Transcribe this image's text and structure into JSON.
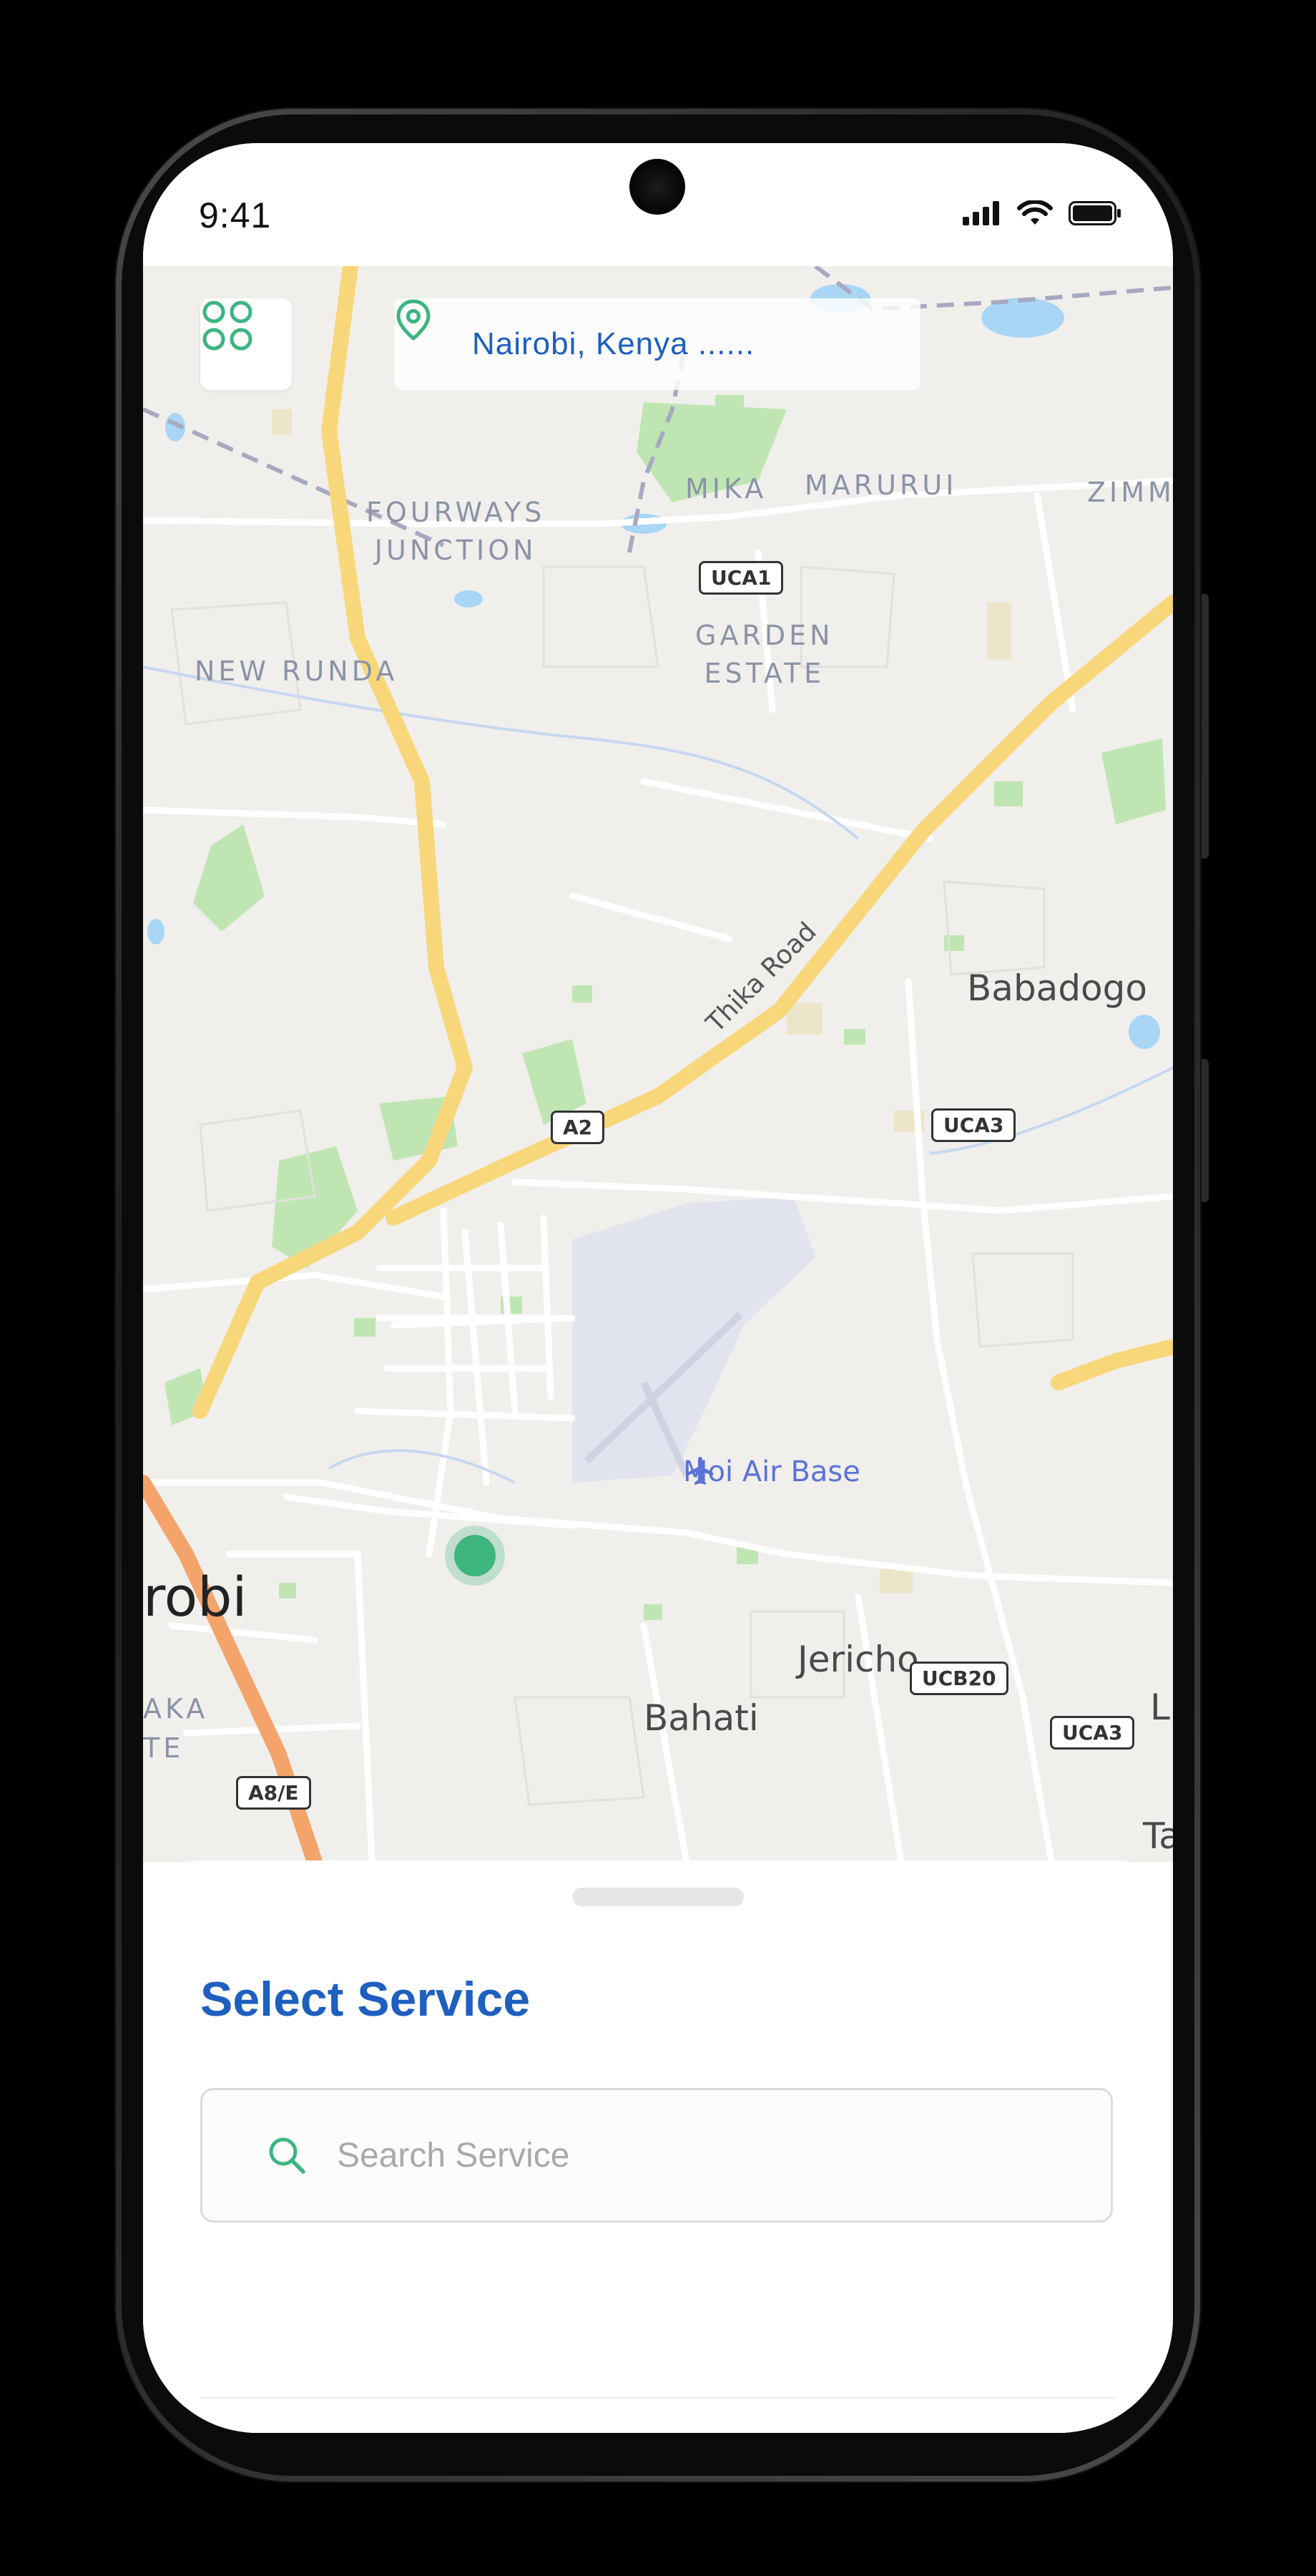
{
  "status_bar": {
    "time": "9:41"
  },
  "map": {
    "location_text": "Nairobi, Kenya ......",
    "area_labels": {
      "fourways_1": "FOURWAYS",
      "fourways_2": "JUNCTION",
      "mika": "MIKA",
      "marurui": "MARURUI",
      "zimm": "ZIMM",
      "garden_1": "GARDEN",
      "garden_2": "ESTATE",
      "new_runda": "NEW RUNDA",
      "kaka": "AKA",
      "te": "TE"
    },
    "place_labels": {
      "babadogo": "Babadogo",
      "airbase": "Moi Air Base",
      "nairobi_partial": "robi",
      "jericho": "Jericho",
      "bahati": "Bahati",
      "l_partial": "L",
      "ta_partial": "Ta"
    },
    "road_label": "Thika Road",
    "shields": {
      "uca1": "UCA1",
      "a2": "A2",
      "uca3_top": "UCA3",
      "ucb20": "UCB20",
      "uca3_bottom": "UCA3",
      "a8e": "A8/E"
    }
  },
  "sheet": {
    "title": "Select Service",
    "search_placeholder": "Search Service",
    "search_value": ""
  },
  "colors": {
    "accent_blue": "#1e5fbf",
    "accent_green": "#3cb57f",
    "map_background": "#f1efec",
    "major_road": "#f8d77a"
  },
  "icons": {
    "menu": "grid-icon",
    "location": "location-pin-icon",
    "search": "search-icon",
    "airport": "airplane-icon"
  }
}
